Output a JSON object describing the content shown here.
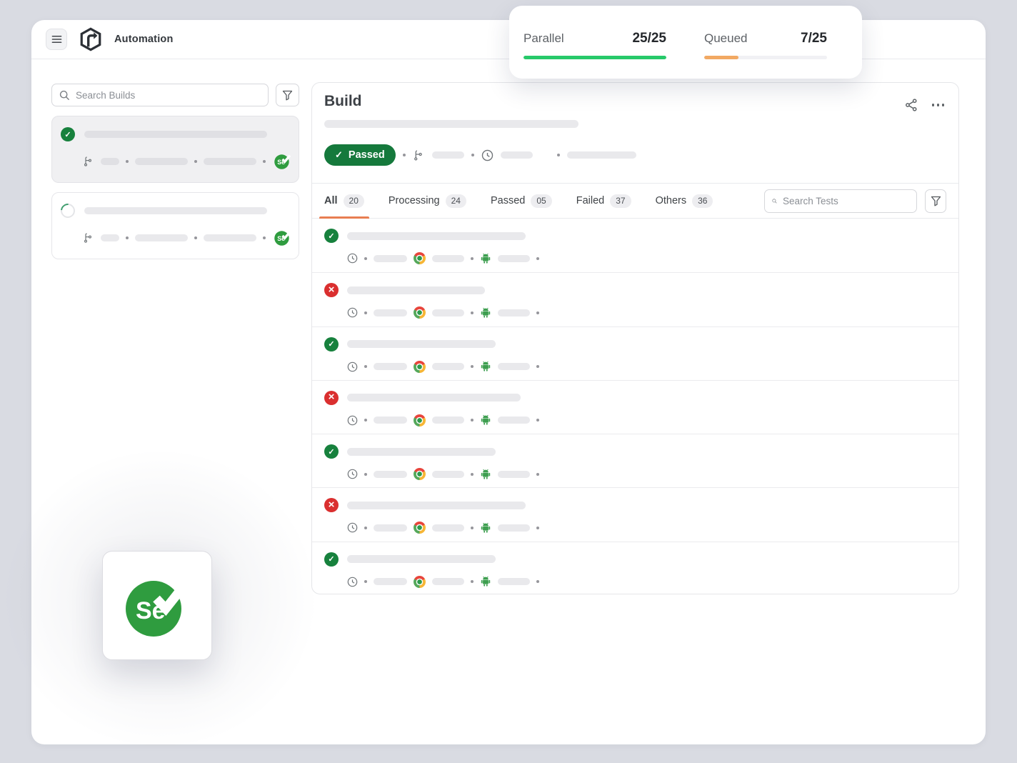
{
  "app": {
    "title": "Automation"
  },
  "usage_card": {
    "parallel": {
      "label": "Parallel",
      "value": "25/25",
      "percent": 100
    },
    "queued": {
      "label": "Queued",
      "value": "7/25",
      "percent": 28
    }
  },
  "sidebar": {
    "search_placeholder": "Search Builds",
    "builds": [
      {
        "status": "passed",
        "selected": true,
        "framework": "selenium"
      },
      {
        "status": "running",
        "selected": false,
        "framework": "selenium"
      }
    ]
  },
  "build_panel": {
    "title": "Build",
    "status_badge": "Passed",
    "search_placeholder": "Search Tests",
    "tabs": [
      {
        "label": "All",
        "count": "20",
        "active": true
      },
      {
        "label": "Processing",
        "count": "24",
        "active": false
      },
      {
        "label": "Passed",
        "count": "05",
        "active": false
      },
      {
        "label": "Failed",
        "count": "37",
        "active": false
      },
      {
        "label": "Others",
        "count": "36",
        "active": false
      }
    ],
    "tests": [
      {
        "status": "passed"
      },
      {
        "status": "failed"
      },
      {
        "status": "passed"
      },
      {
        "status": "failed"
      },
      {
        "status": "passed"
      },
      {
        "status": "failed"
      },
      {
        "status": "passed"
      }
    ]
  },
  "icons": {
    "check_glyph": "✓",
    "fail_glyph": "×",
    "selenium_label": "Se"
  },
  "colors": {
    "success_green": "#17813d",
    "error_red": "#da2f2f",
    "active_tab_orange": "#e87e51",
    "parallel_bar_green": "#27c96a",
    "queued_bar_orange": "#f2a963",
    "selenium_green": "#2f9c3f"
  }
}
